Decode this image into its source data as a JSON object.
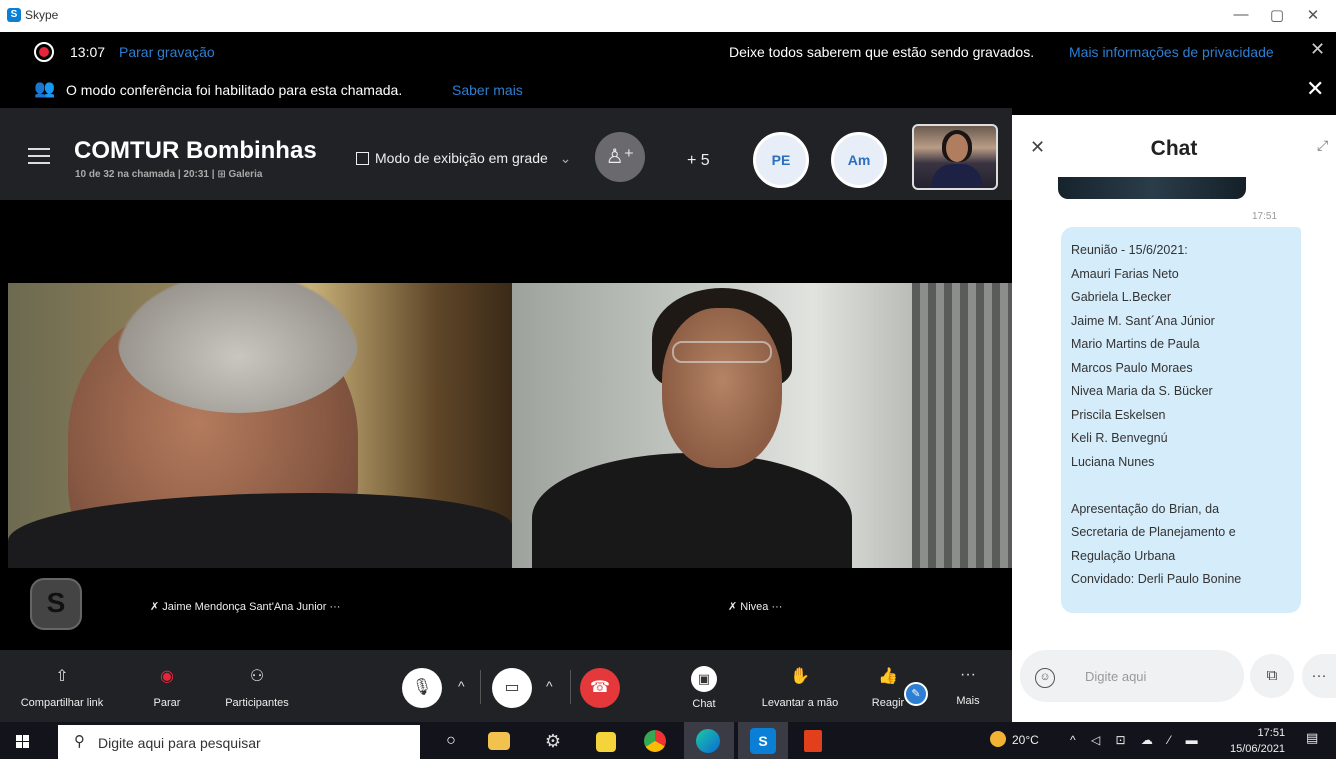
{
  "window": {
    "title": "Skype",
    "logo": "S",
    "minimize": "—",
    "maximize": "▢",
    "close": "✕"
  },
  "recording": {
    "time": "13:07",
    "stop_link": "Parar gravação",
    "notice": "Deixe todos saberem que estão sendo gravados.",
    "privacy_link": "Mais informações de privacidade",
    "close": "✕"
  },
  "conference": {
    "notice": "O modo conferência foi habilitado para esta chamada.",
    "learn_link": "Saber mais",
    "close": "✕"
  },
  "header": {
    "title": "COMTUR Bombinhas",
    "subtitle": "10 de 32 na chamada | 20:31 | ⊞ Galeria",
    "view_mode": "Modo de exibição em grade",
    "view_caret": "⌄",
    "add_icon": "♙⁺",
    "extra_count": "+ 5",
    "avatars": [
      "PE",
      "Am"
    ]
  },
  "participants": {
    "left_name": "Jaime Mendonça Sant'Ana Junior",
    "right_name": "Nivea",
    "more": "···",
    "mute_icon": "🎤̸",
    "skype_avatar": "S"
  },
  "toolbar": {
    "share": "Compartilhar link",
    "stop": "Parar",
    "participants": "Participantes",
    "chat": "Chat",
    "raise_hand": "Levantar a mão",
    "react": "Reagir",
    "more": "Mais",
    "share_icon": "⇧",
    "stop_icon": "◉",
    "people_icon": "⚇",
    "mic_icon": "🎙",
    "cam_icon": "▭",
    "caret": "^",
    "end_icon": "☎",
    "chat_icon": "▣",
    "hand_icon": "✋",
    "react_icon": "👍",
    "more_icon": "···"
  },
  "chat": {
    "title": "Chat",
    "close": "✕",
    "expand": "⤢",
    "time": "17:51",
    "message": [
      "Reunião - 15/6/2021:",
      "Amauri Farias Neto",
      "Gabriela L.Becker",
      "Jaime M. Sant´Ana Júnior",
      "Mario Martins de Paula",
      "Marcos Paulo Moraes",
      "Nivea Maria da S. Bücker",
      "Priscila Eskelsen",
      "Keli R. Benvegnú",
      "Luciana Nunes",
      "",
      "Apresentação do Brian, da",
      "Secretaria de Planejamento e",
      "Regulação Urbana",
      "Convidado: Derli Paulo Bonine"
    ],
    "placeholder": "Digite aqui",
    "smile_icon": "☺",
    "media_icon": "⧉",
    "more_icon": "···"
  },
  "taskbar": {
    "search_placeholder": "Digite aqui para pesquisar",
    "search_icon": "⚲",
    "task_view_icon": "○",
    "temperature": "20°C",
    "tray_icons": "^ ◁ ⊡ ☁ ⁄ ▬",
    "time": "17:51",
    "date": "15/06/2021",
    "notif_icon": "▤"
  }
}
